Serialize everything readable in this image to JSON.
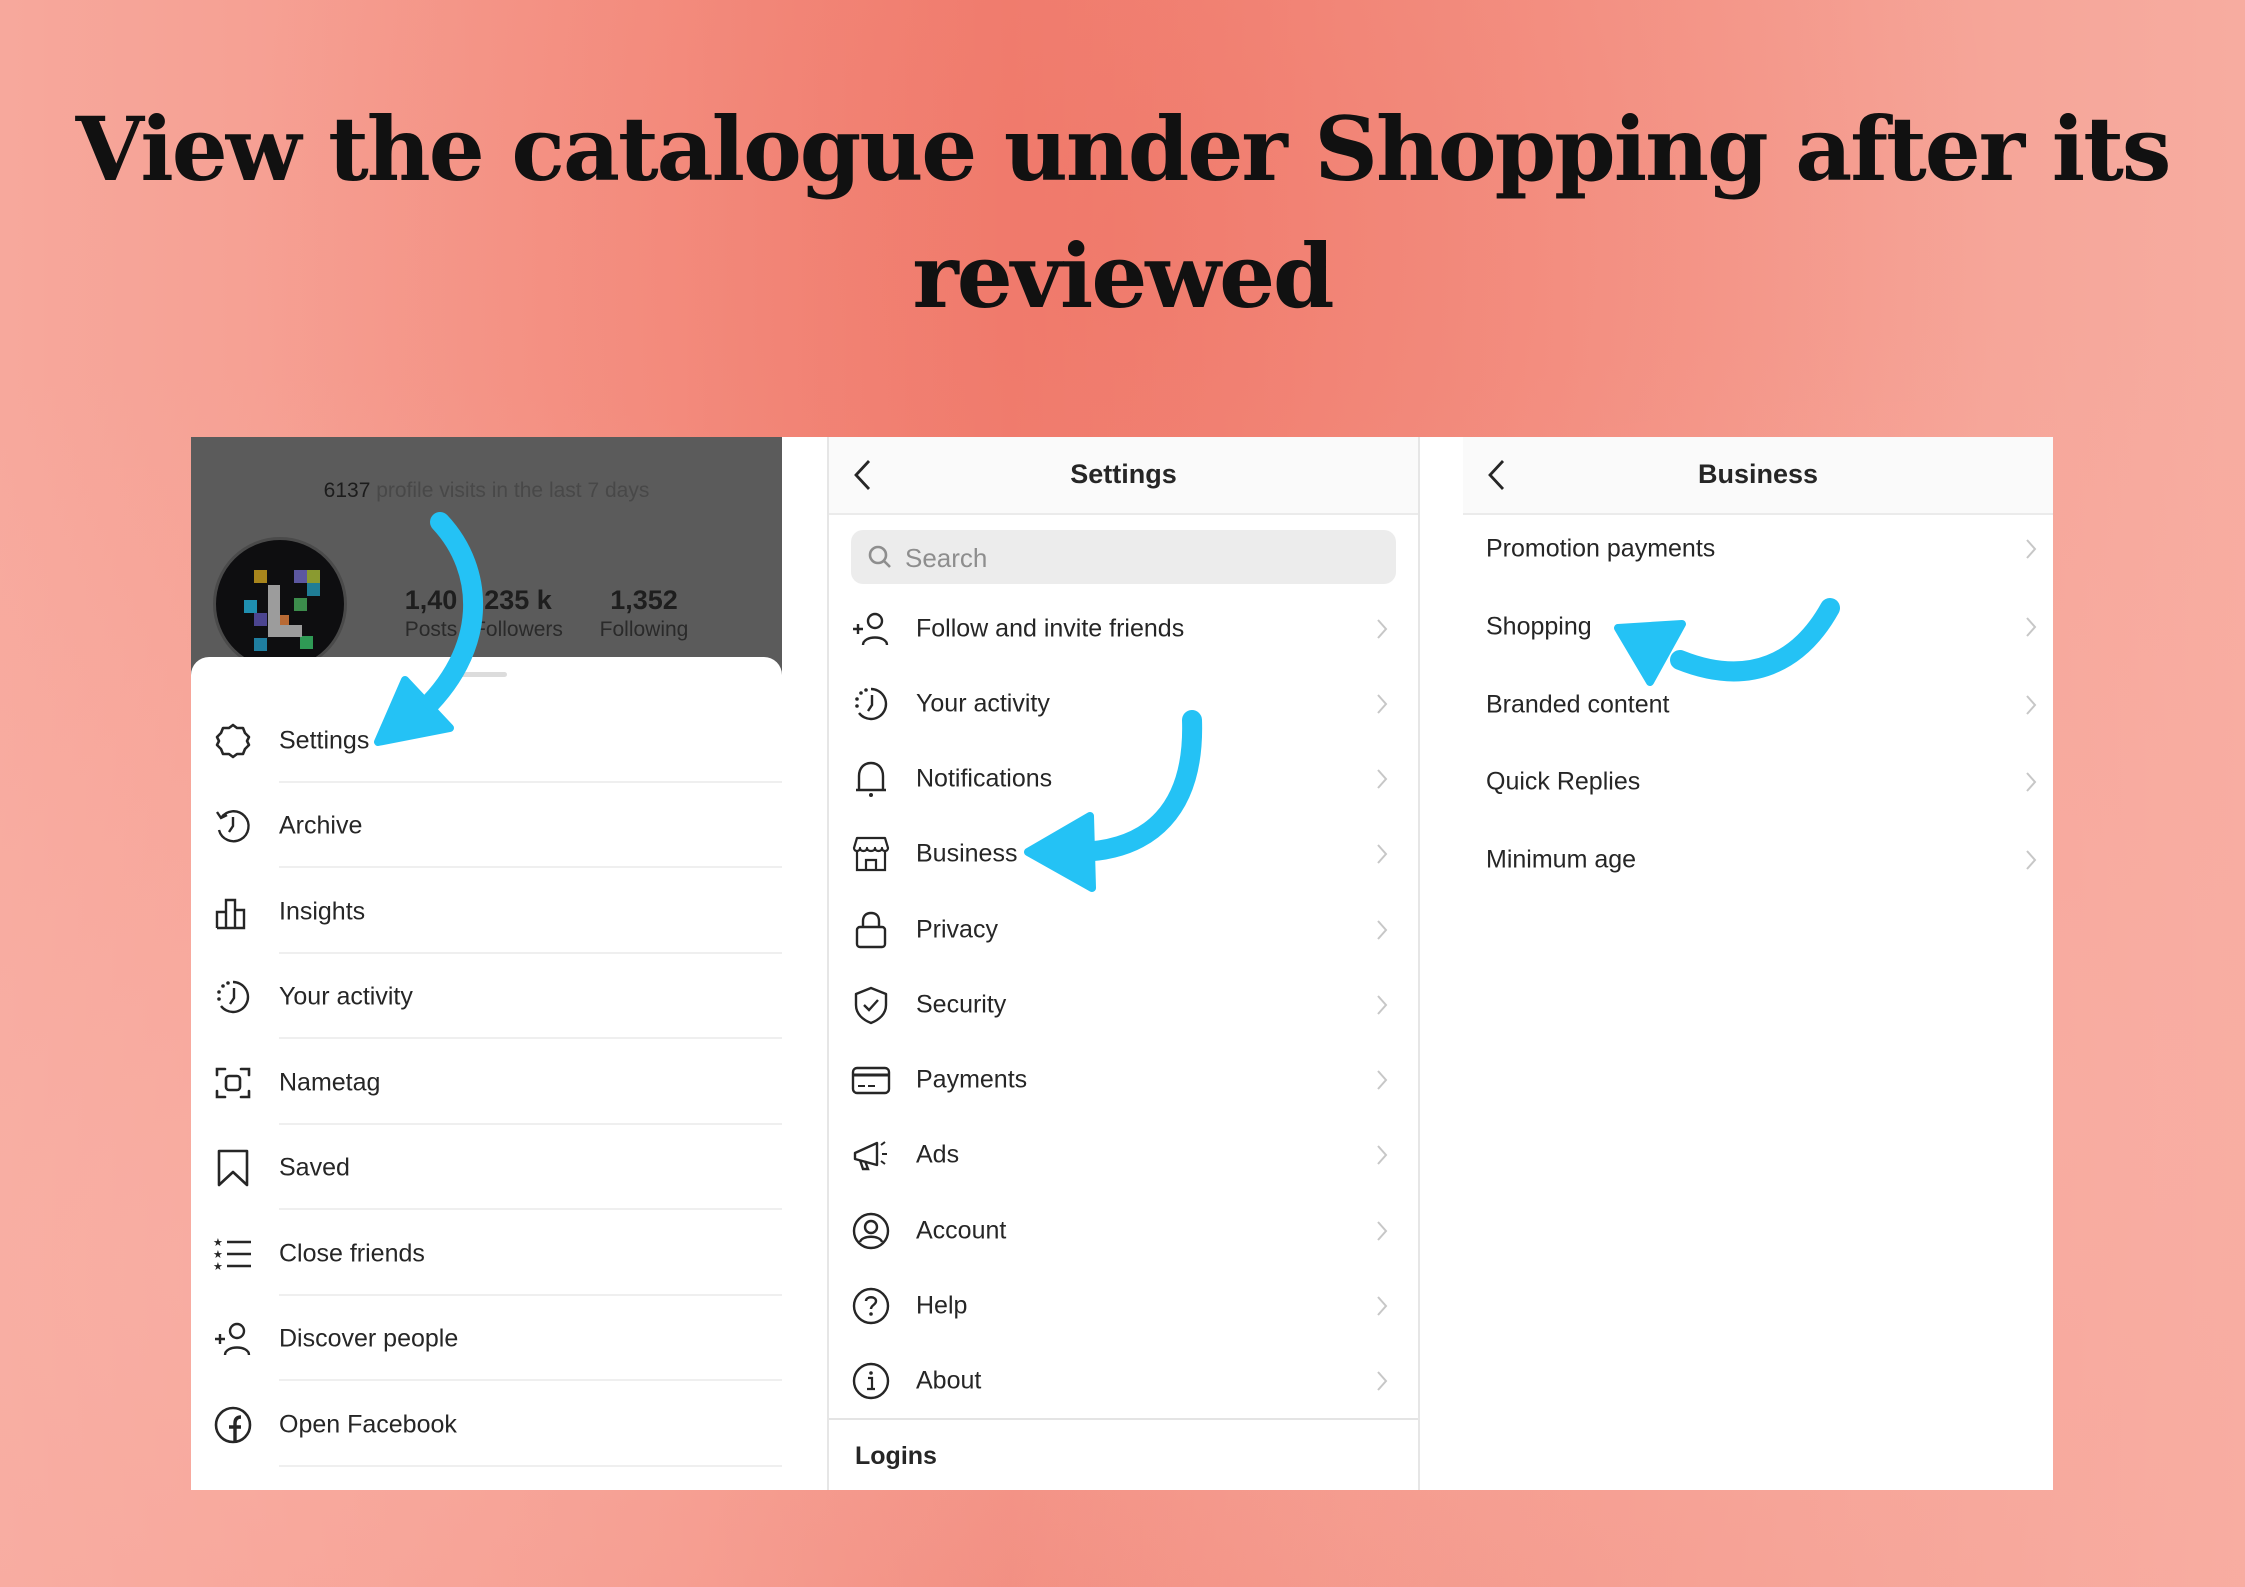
{
  "title": {
    "line1": "View the catalogue under Shopping after its",
    "line2": "reviewed"
  },
  "colors": {
    "arrow": "#24c2f5",
    "background": "#f39486",
    "profile_overlay": "#5b5b5b",
    "text": "#262626"
  },
  "profile_screen": {
    "visits_count": "6137",
    "visits_text": " profile visits in the last 7 days",
    "stats": [
      {
        "value": "1,40",
        "label": "Posts"
      },
      {
        "value": "235 k",
        "label": "Followers"
      },
      {
        "value": "1,352",
        "label": "Following"
      }
    ],
    "menu": [
      {
        "label": "Settings",
        "icon": "gear-icon"
      },
      {
        "label": "Archive",
        "icon": "archive-clock-icon"
      },
      {
        "label": "Insights",
        "icon": "bar-chart-icon"
      },
      {
        "label": "Your activity",
        "icon": "activity-clock-icon"
      },
      {
        "label": "Nametag",
        "icon": "nametag-scan-icon"
      },
      {
        "label": "Saved",
        "icon": "bookmark-icon"
      },
      {
        "label": "Close friends",
        "icon": "star-list-icon"
      },
      {
        "label": "Discover people",
        "icon": "add-person-icon"
      },
      {
        "label": "Open Facebook",
        "icon": "facebook-icon"
      }
    ]
  },
  "settings_screen": {
    "title": "Settings",
    "search_placeholder": "Search",
    "items": [
      {
        "label": "Follow and invite friends",
        "icon": "add-person-icon"
      },
      {
        "label": "Your activity",
        "icon": "activity-clock-icon"
      },
      {
        "label": "Notifications",
        "icon": "bell-icon"
      },
      {
        "label": "Business",
        "icon": "storefront-icon"
      },
      {
        "label": "Privacy",
        "icon": "lock-icon"
      },
      {
        "label": "Security",
        "icon": "shield-check-icon"
      },
      {
        "label": "Payments",
        "icon": "credit-card-icon"
      },
      {
        "label": "Ads",
        "icon": "megaphone-icon"
      },
      {
        "label": "Account",
        "icon": "account-circle-icon"
      },
      {
        "label": "Help",
        "icon": "help-circle-icon"
      },
      {
        "label": "About",
        "icon": "info-circle-icon"
      }
    ],
    "section_label": "Logins"
  },
  "business_screen": {
    "title": "Business",
    "items": [
      {
        "label": "Promotion payments"
      },
      {
        "label": "Shopping"
      },
      {
        "label": "Branded content"
      },
      {
        "label": "Quick Replies"
      },
      {
        "label": "Minimum age"
      }
    ]
  }
}
